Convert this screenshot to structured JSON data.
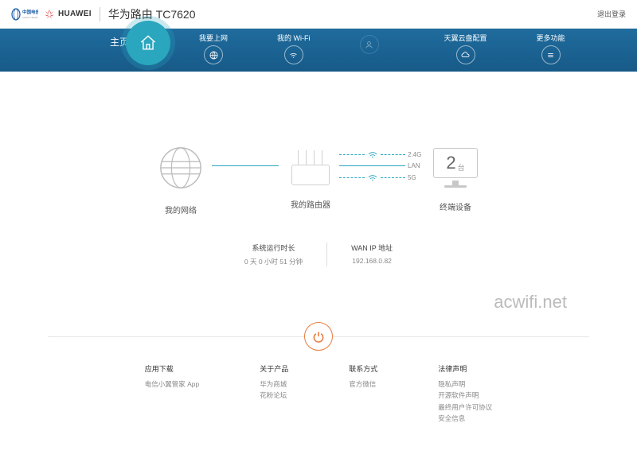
{
  "header": {
    "title": "华为路由 TC7620",
    "logout": "退出登录",
    "huawei": "HUAWEI"
  },
  "nav": {
    "home": "主页",
    "items": [
      {
        "label": "我要上网"
      },
      {
        "label": "我的 Wi-Fi"
      },
      {
        "label": ""
      },
      {
        "label": "天翼云盘配置"
      },
      {
        "label": "更多功能"
      }
    ]
  },
  "diagram": {
    "network_label": "我的网络",
    "router_label": "我的路由器",
    "terminals_label": "终端设备",
    "terminals_count": "2",
    "terminals_unit": "台",
    "band_24": "2.4G",
    "lan": "LAN",
    "band_5": "5G"
  },
  "stats": {
    "uptime_label": "系统运行时长",
    "uptime_value": "0 天 0 小时 51 分钟",
    "wan_label": "WAN IP 地址",
    "wan_value": "192.168.0.82"
  },
  "watermark": "acwifi.net",
  "footer": {
    "cols": [
      {
        "title": "应用下载",
        "items": [
          "电信小翼管家 App"
        ]
      },
      {
        "title": "关于产品",
        "items": [
          "华为商城",
          "花粉论坛"
        ]
      },
      {
        "title": "联系方式",
        "items": [
          "官方微信"
        ]
      },
      {
        "title": "法律声明",
        "items": [
          "隐私声明",
          "开源软件声明",
          "最终用户许可协议",
          "安全信息"
        ]
      }
    ]
  }
}
